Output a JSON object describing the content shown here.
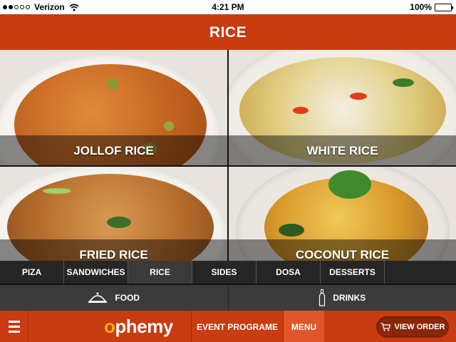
{
  "status_bar": {
    "carrier": "Verizon",
    "time": "4:21 PM",
    "battery": "100%",
    "battery_level": 1.0,
    "signal_dots_filled": 2,
    "signal_dots_total": 5
  },
  "header": {
    "title": "RICE"
  },
  "dishes": [
    {
      "label": "JOLLOF RICE"
    },
    {
      "label": "WHITE RICE"
    },
    {
      "label": "FRIED RICE"
    },
    {
      "label": "COCONUT RICE"
    }
  ],
  "categories": [
    {
      "label": "PIZA",
      "active": false
    },
    {
      "label": "SANDWICHES",
      "active": false
    },
    {
      "label": "RICE",
      "active": true
    },
    {
      "label": "SIDES",
      "active": false
    },
    {
      "label": "DOSA",
      "active": false
    },
    {
      "label": "DESSERTS",
      "active": false
    }
  ],
  "sections": {
    "food": {
      "label": "FOOD",
      "icon": "cloche-icon"
    },
    "drinks": {
      "label": "DRINKS",
      "icon": "bottle-icon"
    }
  },
  "bottom_bar": {
    "logo": "ophemy",
    "event_label": "EVENT PROGRAME",
    "menu_label": "MENU",
    "view_order_label": "VIEW ORDER",
    "cart_icon": "cart-icon",
    "menu_icon": "hamburger-icon"
  },
  "colors": {
    "brand": "#c93b10",
    "brand_dark": "#8a270a",
    "active_tab": "#e0552a"
  }
}
